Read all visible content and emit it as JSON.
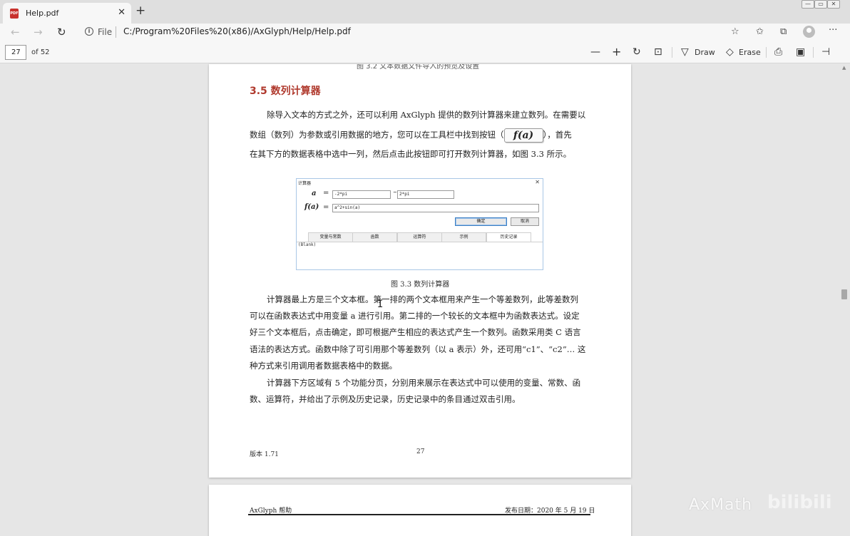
{
  "tab": {
    "title": "Help.pdf",
    "pdf_icon_text": "PDF"
  },
  "address": {
    "file_label": "File",
    "url": "C:/Program%20Files%20(x86)/AxGlyph/Help/Help.pdf"
  },
  "pdf_toolbar": {
    "page_number": "27",
    "page_of": "of 52",
    "draw_label": "Draw",
    "erase_label": "Erase"
  },
  "page": {
    "prev_caption_cut": "图 3.2  文本数据文件导入的预览及设置",
    "section_title": "3.5  数列计算器",
    "para1": {
      "line1": "除导入文本的方式之外，还可以利用 AxGlyph 提供的数列计算器来建立数列。在需要以",
      "line2a": "数组（数列）为参数或引用数据的地方，您可以在工具栏中找到按钮（",
      "line2_btn": "f(a)",
      "line2b": "），首先",
      "line3": "在其下方的数据表格中选中一列，然后点击此按钮即可打开数列计算器，如图 3.3 所示。"
    },
    "figure": {
      "window_title": "计算器",
      "close": "✕",
      "label_a": "a",
      "eq": "=",
      "start_value": "-2*pi",
      "tilde": "~",
      "end_value": "2*pi",
      "label_fa": "f(a)",
      "expr_value": "a^2+sin(a)",
      "ok_label": "确定",
      "cancel_label": "取消",
      "tabs": [
        "变量与常数",
        "函数",
        "运算符",
        "示例",
        "历史记录"
      ],
      "blank": "(Blank)"
    },
    "figure_caption": "图 3.3  数列计算器",
    "para2": [
      "计算器最上方是三个文本框。第一排的两个文本框用来产生一个等差数列，此等差数列",
      "可以在函数表达式中用变量 a 进行引用。第二排的一个较长的文本框中为函数表达式。设定",
      "好三个文本框后，点击确定，即可根据产生相应的表达式产生一个数列。函数采用类 C 语言",
      "语法的表达方式。函数中除了可引用那个等差数列（以 a 表示）外，还可用“c1”、“c2”… 这",
      "种方式来引用调用者数据表格中的数据。"
    ],
    "para3": [
      "计算器下方区域有 5 个功能分页，分别用来展示在表达式中可以使用的变量、常数、函",
      "数、运算符，并给出了示例及历史记录，历史记录中的条目通过双击引用。"
    ],
    "footer_version": "版本  1.71",
    "footer_page": "27"
  },
  "page2": {
    "header_left": "AxGlyph 帮助",
    "header_right": "发布日期：2020 年 5 月 19 日"
  },
  "watermark": {
    "text": "AxMath",
    "logo": "bilibili"
  }
}
